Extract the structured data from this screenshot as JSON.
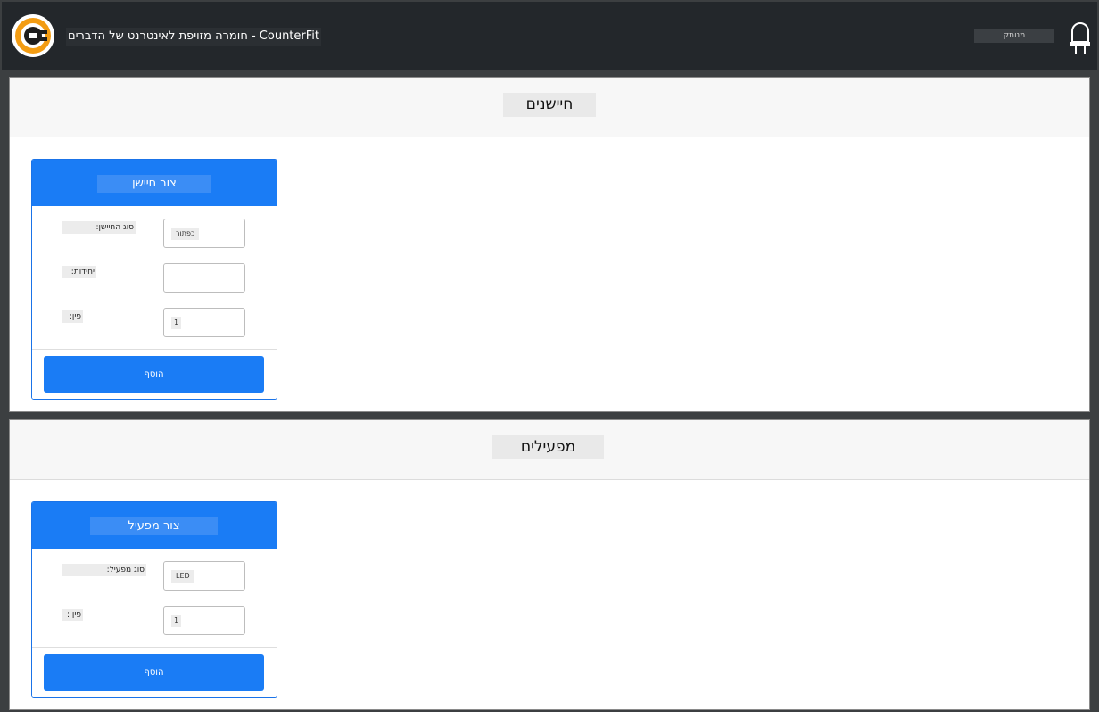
{
  "header": {
    "title": "CounterFit - חומרה מזויפת לאינטרנט של הדברים",
    "status": "מנותק",
    "logo_icon": "counterfit-logo-icon",
    "status_icon": "led-bulb-icon"
  },
  "sensors": {
    "heading": "חיישנים",
    "card": {
      "title": "צור חיישן",
      "type_label": "סוג החיישן:",
      "type_value": "כפתור",
      "units_label": "יחידות:",
      "pin_label": "פין:",
      "pin_value": "1",
      "add_label": "הוסף"
    }
  },
  "actuators": {
    "heading": "מפעילים",
    "card": {
      "title": "צור מפעיל",
      "type_label": "סוג מפעיל:",
      "type_value": "LED",
      "pin_label": "פין :",
      "pin_value": "1",
      "add_label": "הוסף"
    }
  },
  "colors": {
    "accent": "#1a7cf5",
    "topbar": "#23272b",
    "logo_orange": "#f39c12"
  }
}
